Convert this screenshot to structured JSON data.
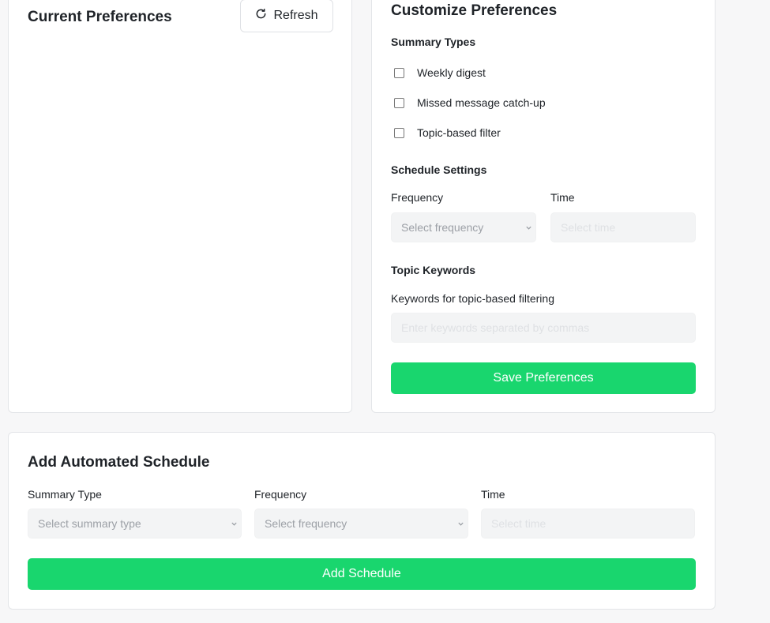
{
  "current": {
    "title": "Current Preferences",
    "refresh_label": "Refresh"
  },
  "customize": {
    "title": "Customize Preferences",
    "summary_types_heading": "Summary Types",
    "summary_types": [
      {
        "label": "Weekly digest",
        "checked": false
      },
      {
        "label": "Missed message catch-up",
        "checked": false
      },
      {
        "label": "Topic-based filter",
        "checked": false
      }
    ],
    "schedule_heading": "Schedule Settings",
    "frequency_label": "Frequency",
    "frequency_placeholder": "Select frequency",
    "time_label": "Time",
    "time_placeholder": "Select time",
    "topic_heading": "Topic Keywords",
    "keywords_label": "Keywords for topic-based filtering",
    "keywords_placeholder": "Enter keywords separated by commas",
    "save_label": "Save Preferences"
  },
  "schedule": {
    "title": "Add Automated Schedule",
    "summary_type_label": "Summary Type",
    "summary_type_placeholder": "Select summary type",
    "frequency_label": "Frequency",
    "frequency_placeholder": "Select frequency",
    "time_label": "Time",
    "time_placeholder": "Select time",
    "add_label": "Add Schedule"
  },
  "colors": {
    "accent": "#19d66e",
    "card_border": "#e3e5e8",
    "field_bg": "#f3f4f5"
  }
}
